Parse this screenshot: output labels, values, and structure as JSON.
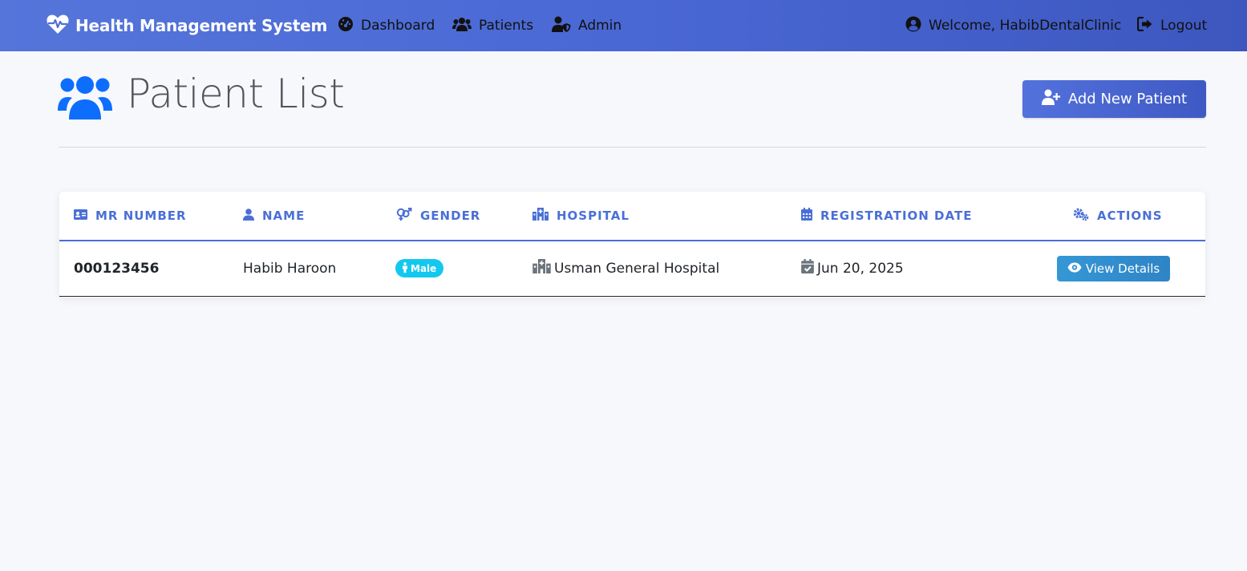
{
  "nav": {
    "brand": "Health Management System",
    "links": [
      {
        "label": "Dashboard",
        "icon": "gauge-icon"
      },
      {
        "label": "Patients",
        "icon": "users-icon"
      },
      {
        "label": "Admin",
        "icon": "user-shield-icon"
      }
    ],
    "welcome": "Welcome, HabibDentalClinic",
    "logout": "Logout"
  },
  "page": {
    "title": "Patient List",
    "add_button": "Add New Patient"
  },
  "table": {
    "headers": {
      "mr": "MR NUMBER",
      "name": "NAME",
      "gender": "GENDER",
      "hospital": "HOSPITAL",
      "date": "REGISTRATION DATE",
      "actions": "ACTIONS"
    },
    "rows": [
      {
        "mr": "000123456",
        "name": "Habib Haroon",
        "gender": "Male",
        "hospital": "Usman General Hospital",
        "date": "Jun 20, 2025",
        "action": "View Details"
      }
    ]
  },
  "colors": {
    "accent": "#4a6fd6",
    "badge": "#13c8ef",
    "view_button": "#3597d6"
  }
}
